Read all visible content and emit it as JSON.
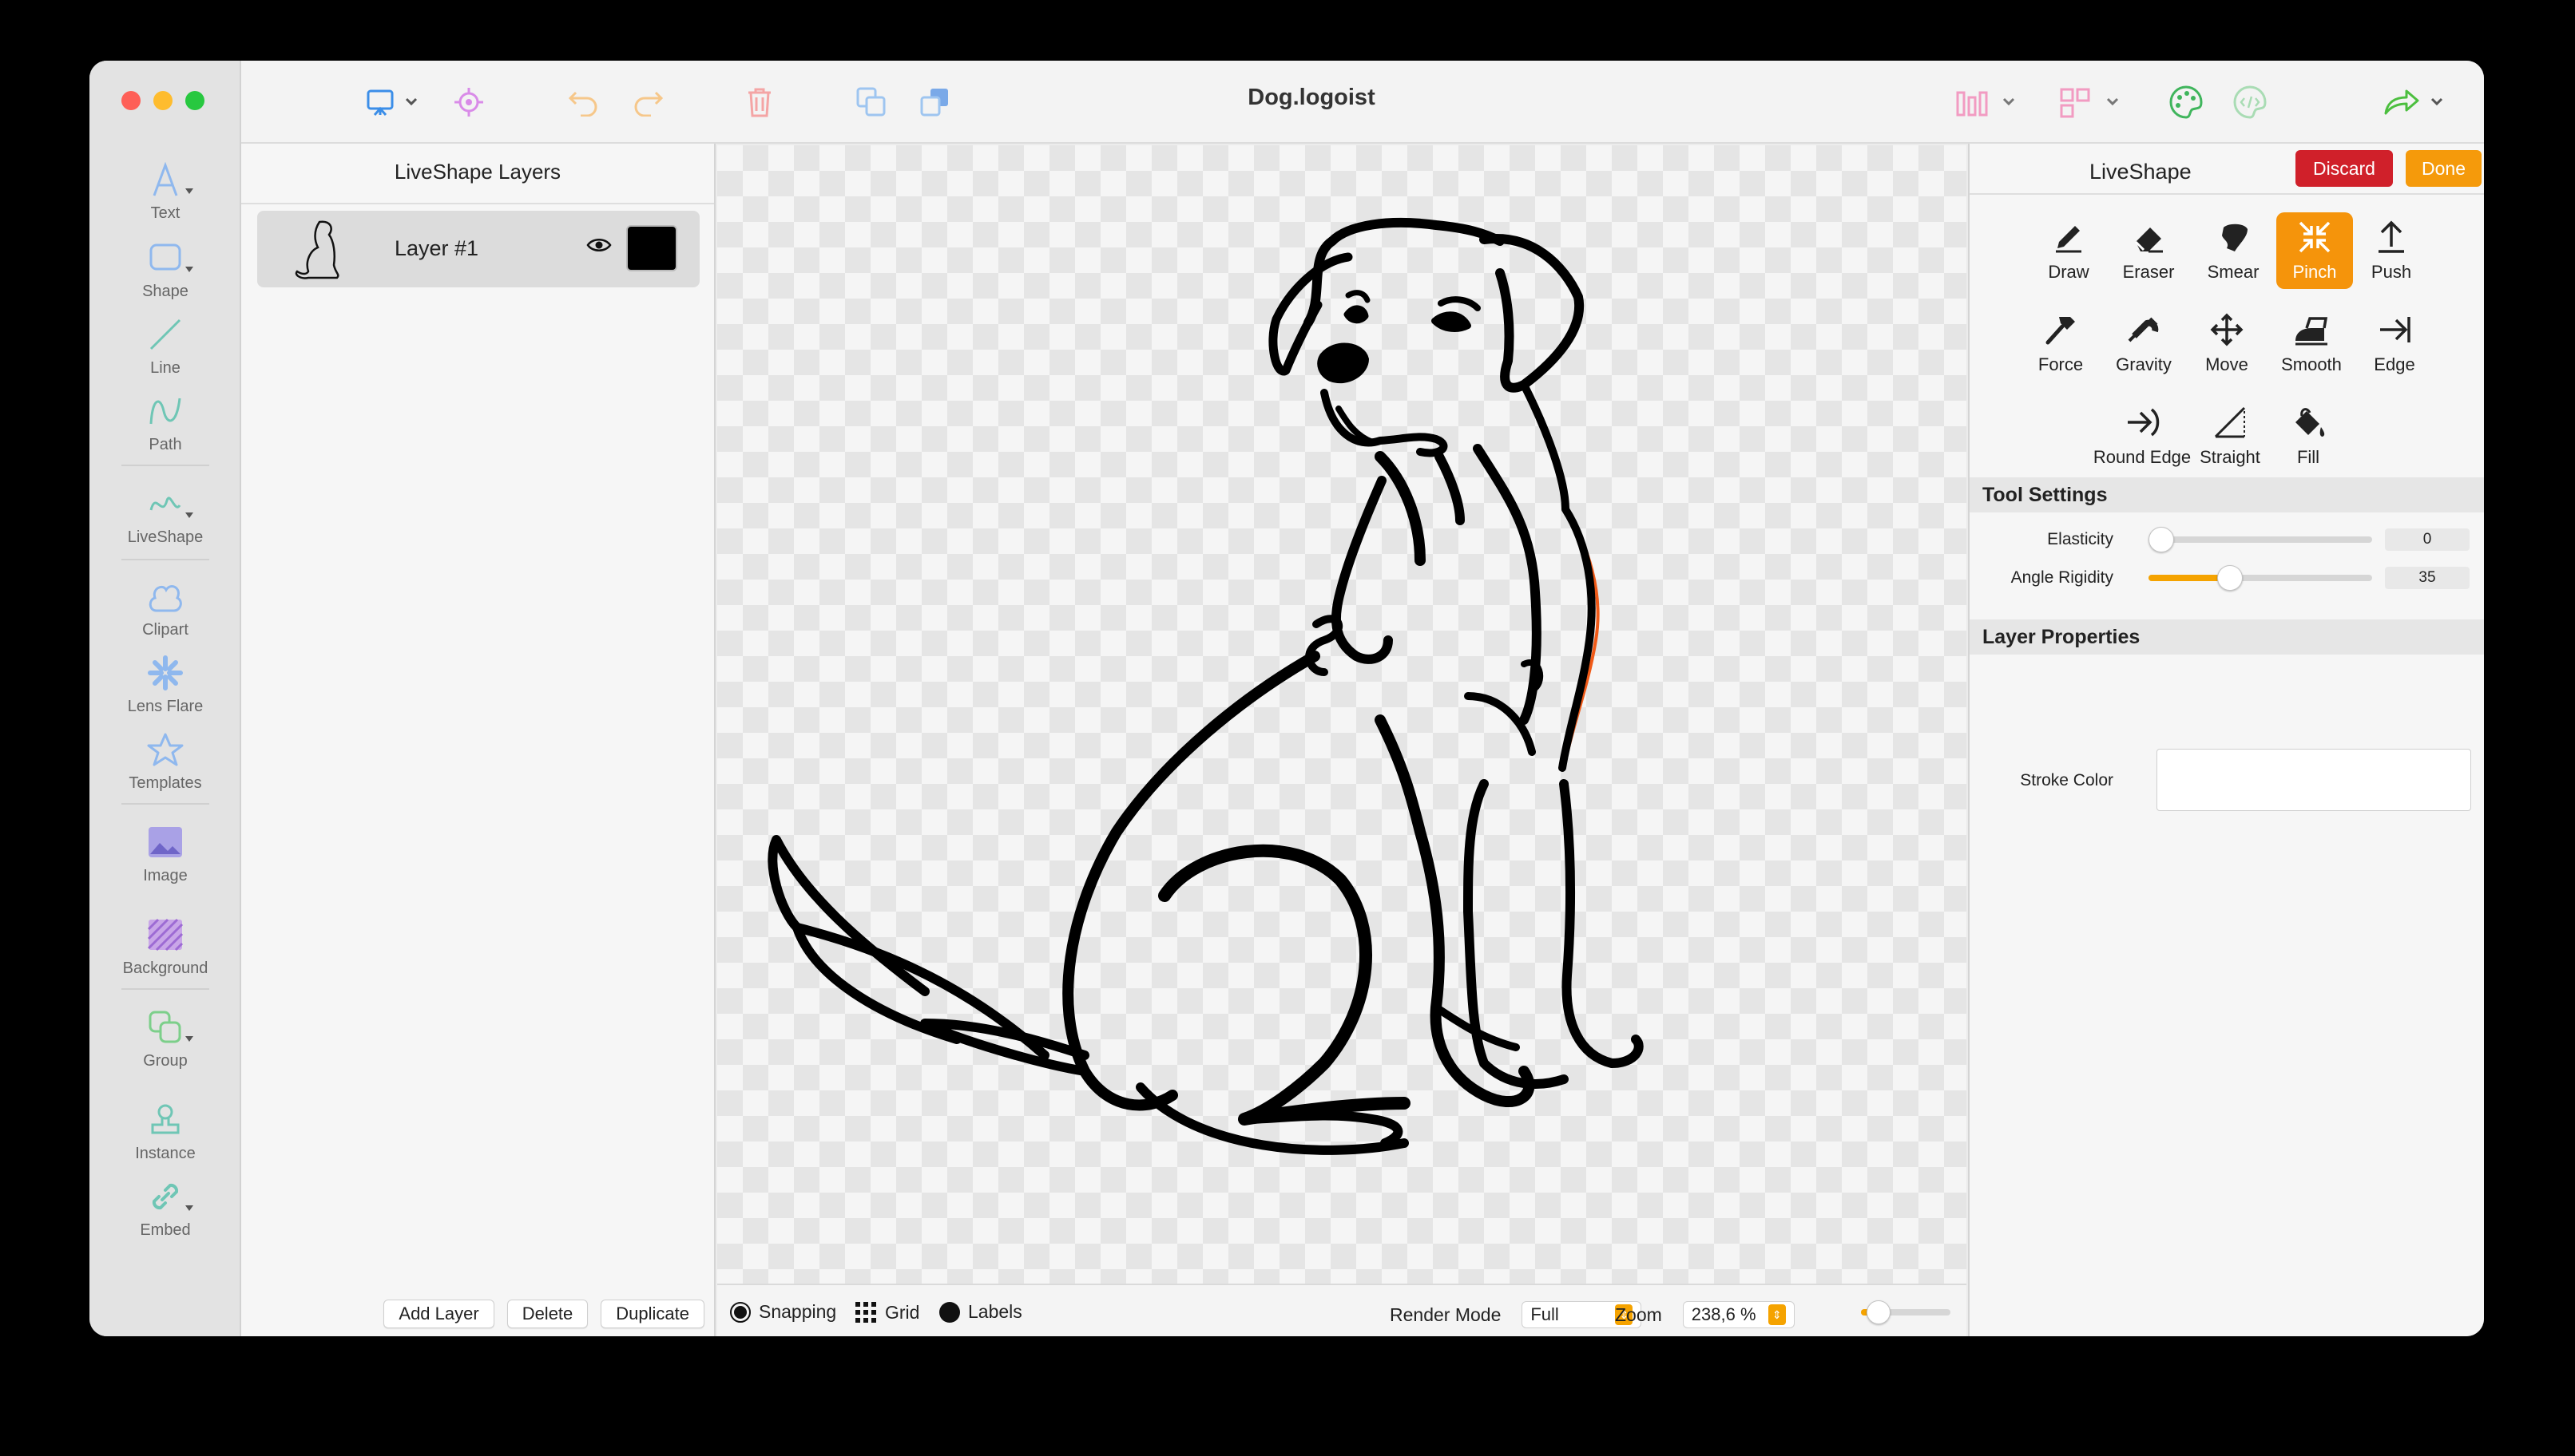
{
  "window": {
    "title": "Dog.logoist"
  },
  "colors": {
    "accent": "#f5940b",
    "discard": "#d0202a",
    "toolbar_icons": "#9ec5f0"
  },
  "sidebar": {
    "tools": [
      {
        "label": "Text",
        "icon": "text-icon"
      },
      {
        "label": "Shape",
        "icon": "shape-icon"
      },
      {
        "label": "Line",
        "icon": "line-icon"
      },
      {
        "label": "Path",
        "icon": "path-icon"
      },
      {
        "label": "LiveShape",
        "icon": "liveshape-icon"
      },
      {
        "label": "Clipart",
        "icon": "clipart-icon"
      },
      {
        "label": "Lens Flare",
        "icon": "lens-flare-icon"
      },
      {
        "label": "Templates",
        "icon": "templates-icon"
      },
      {
        "label": "Image",
        "icon": "image-icon"
      },
      {
        "label": "Background",
        "icon": "background-icon"
      },
      {
        "label": "Group",
        "icon": "group-icon"
      },
      {
        "label": "Instance",
        "icon": "instance-icon"
      },
      {
        "label": "Embed",
        "icon": "embed-icon"
      }
    ]
  },
  "layers": {
    "title": "LiveShape Layers",
    "items": [
      {
        "name": "Layer #1",
        "visible": true,
        "color": "#000000"
      }
    ],
    "buttons": {
      "add": "Add Layer",
      "delete": "Delete",
      "duplicate": "Duplicate"
    }
  },
  "statusbar": {
    "snapping": "Snapping",
    "grid": "Grid",
    "labels": "Labels",
    "render_mode_label": "Render Mode",
    "render_mode_value": "Full",
    "zoom_label": "Zoom",
    "zoom_value": "238,6 %",
    "zoom_slider_level": 0.2
  },
  "inspector": {
    "title": "LiveShape",
    "discard": "Discard",
    "done": "Done",
    "tools": [
      {
        "label": "Draw",
        "icon": "pencil-icon"
      },
      {
        "label": "Eraser",
        "icon": "eraser-icon"
      },
      {
        "label": "Smear",
        "icon": "smear-icon"
      },
      {
        "label": "Pinch",
        "icon": "pinch-icon",
        "active": true
      },
      {
        "label": "Push",
        "icon": "push-icon"
      },
      {
        "label": "Force",
        "icon": "hammer-icon"
      },
      {
        "label": "Gravity",
        "icon": "magnet-icon"
      },
      {
        "label": "Move",
        "icon": "move-icon"
      },
      {
        "label": "Smooth",
        "icon": "iron-icon"
      },
      {
        "label": "Edge",
        "icon": "edge-icon"
      },
      {
        "label": "Round Edge",
        "icon": "round-edge-icon"
      },
      {
        "label": "Straight",
        "icon": "straight-icon"
      },
      {
        "label": "Fill",
        "icon": "fill-icon"
      }
    ],
    "tool_settings": {
      "title": "Tool Settings",
      "elasticity_label": "Elasticity",
      "elasticity_value": "0",
      "angle_label": "Angle Rigidity",
      "angle_value": "35"
    },
    "layer_properties": {
      "title": "Layer Properties",
      "stroke_color_label": "Stroke Color"
    }
  }
}
